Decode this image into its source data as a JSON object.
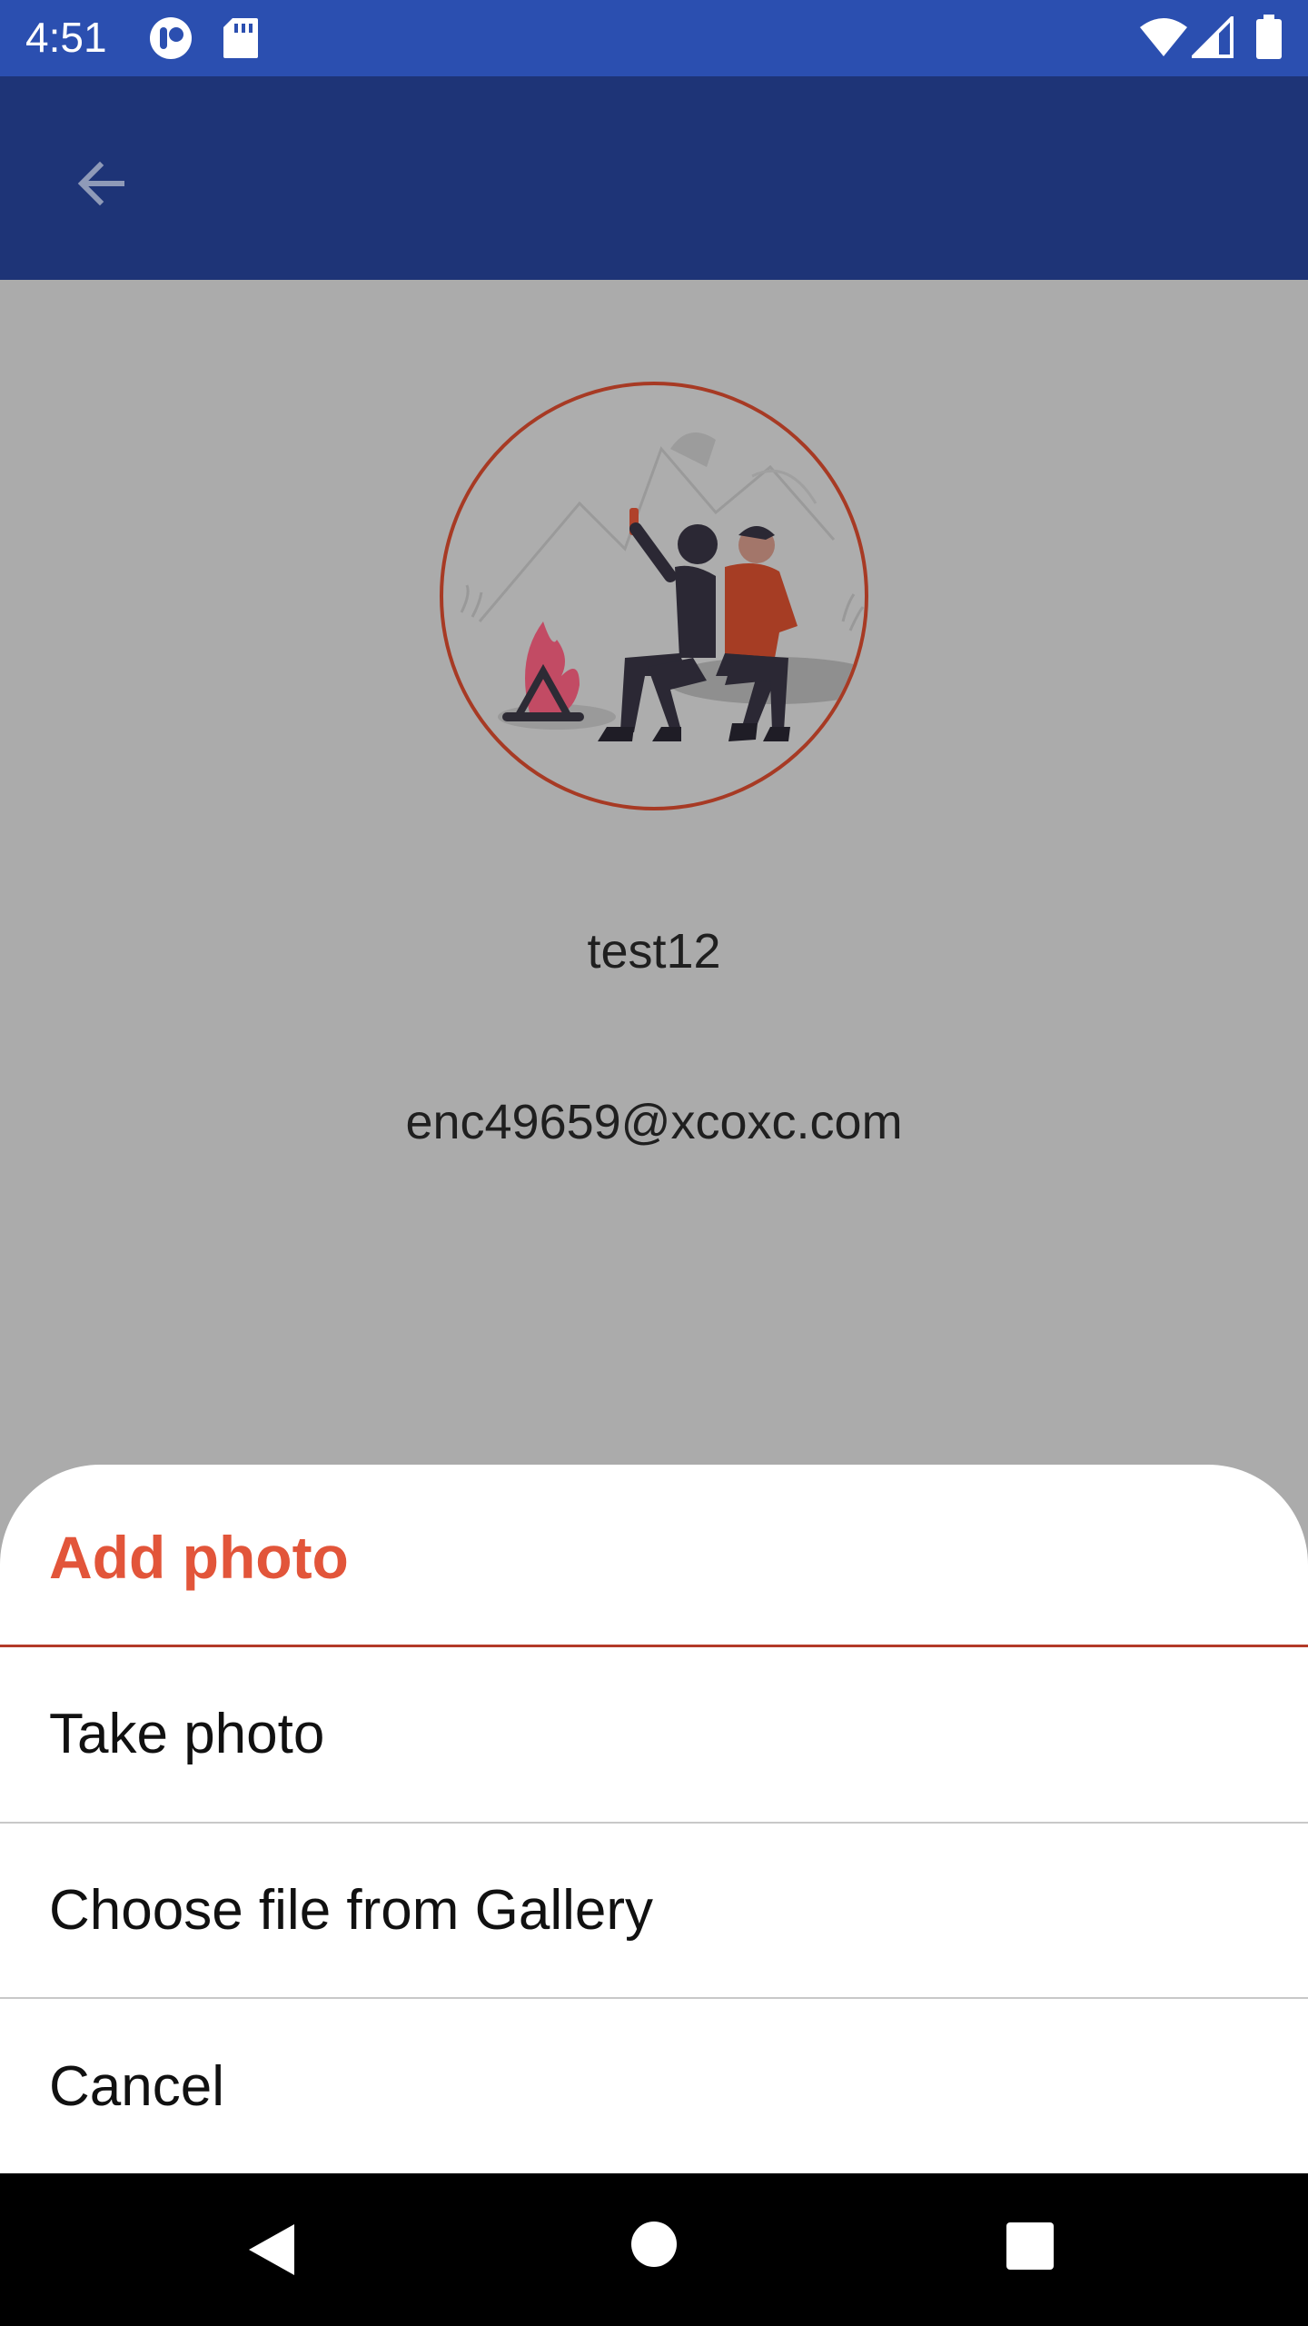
{
  "status_bar": {
    "time": "4:51",
    "icons": [
      "accessibility-icon",
      "sd-card-icon",
      "wifi-icon",
      "cell-signal-icon",
      "battery-icon"
    ]
  },
  "app_bar": {
    "back_icon": "arrow-back-icon"
  },
  "profile": {
    "username": "test12",
    "email": "enc49659@xcoxc.com"
  },
  "sheet": {
    "title": "Add photo",
    "items": [
      {
        "label": "Take photo"
      },
      {
        "label": "Choose file from Gallery"
      },
      {
        "label": "Cancel"
      }
    ]
  },
  "colors": {
    "status_bar": "#2b4fb0",
    "app_bar_dimmed": "#1e3477",
    "accent": "#e2553a",
    "avatar_ring": "#a73a24",
    "scrim": "#ababab"
  },
  "nav_bar": {
    "icons": [
      "nav-back-icon",
      "nav-home-icon",
      "nav-recents-icon"
    ]
  }
}
